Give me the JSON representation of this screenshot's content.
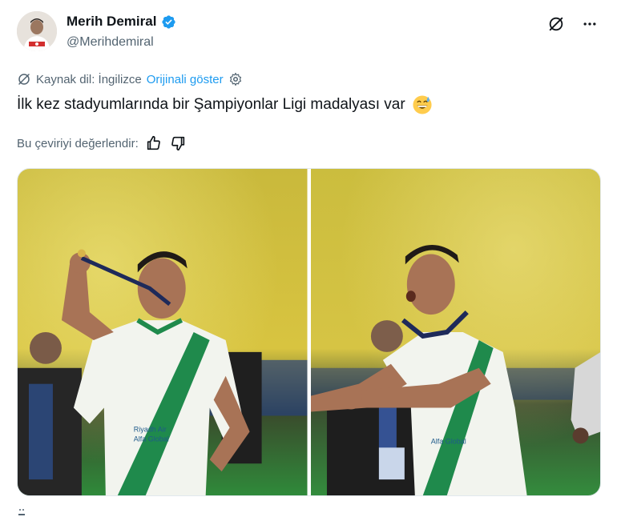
{
  "author": {
    "display_name": "Merih Demiral",
    "handle": "@Merihdemiral",
    "verified": true,
    "verified_color": "#1d9bf0"
  },
  "top_actions": {
    "grok_icon": "grok-slash-icon",
    "more_icon": "more-dots-icon"
  },
  "translation": {
    "source_label": "Kaynak dil: İngilizce",
    "show_original": "Orijinali göster",
    "settings_icon": "gear-icon"
  },
  "tweet": {
    "text": "İlk kez stadyumlarında bir Şampiyonlar Ligi madalyası var",
    "emoji": "grinning-sweat-emoji"
  },
  "rate_translation": {
    "label": "Bu çeviriyi değerlendir:"
  },
  "media": {
    "photos": [
      {
        "alt": "player-biting-medal"
      },
      {
        "alt": "player-celebrating-with-medal"
      }
    ],
    "sponsor_text": "Riyadh Air",
    "sponsor_text_2": "Alfa Global"
  },
  "colors": {
    "link": "#1d9bf0",
    "secondary_text": "#536471",
    "crowd_yellow": "#d9c33a",
    "pitch_green": "#2f8a3a",
    "jersey_white": "#f2f4ee",
    "jersey_green": "#1f8a4c"
  }
}
